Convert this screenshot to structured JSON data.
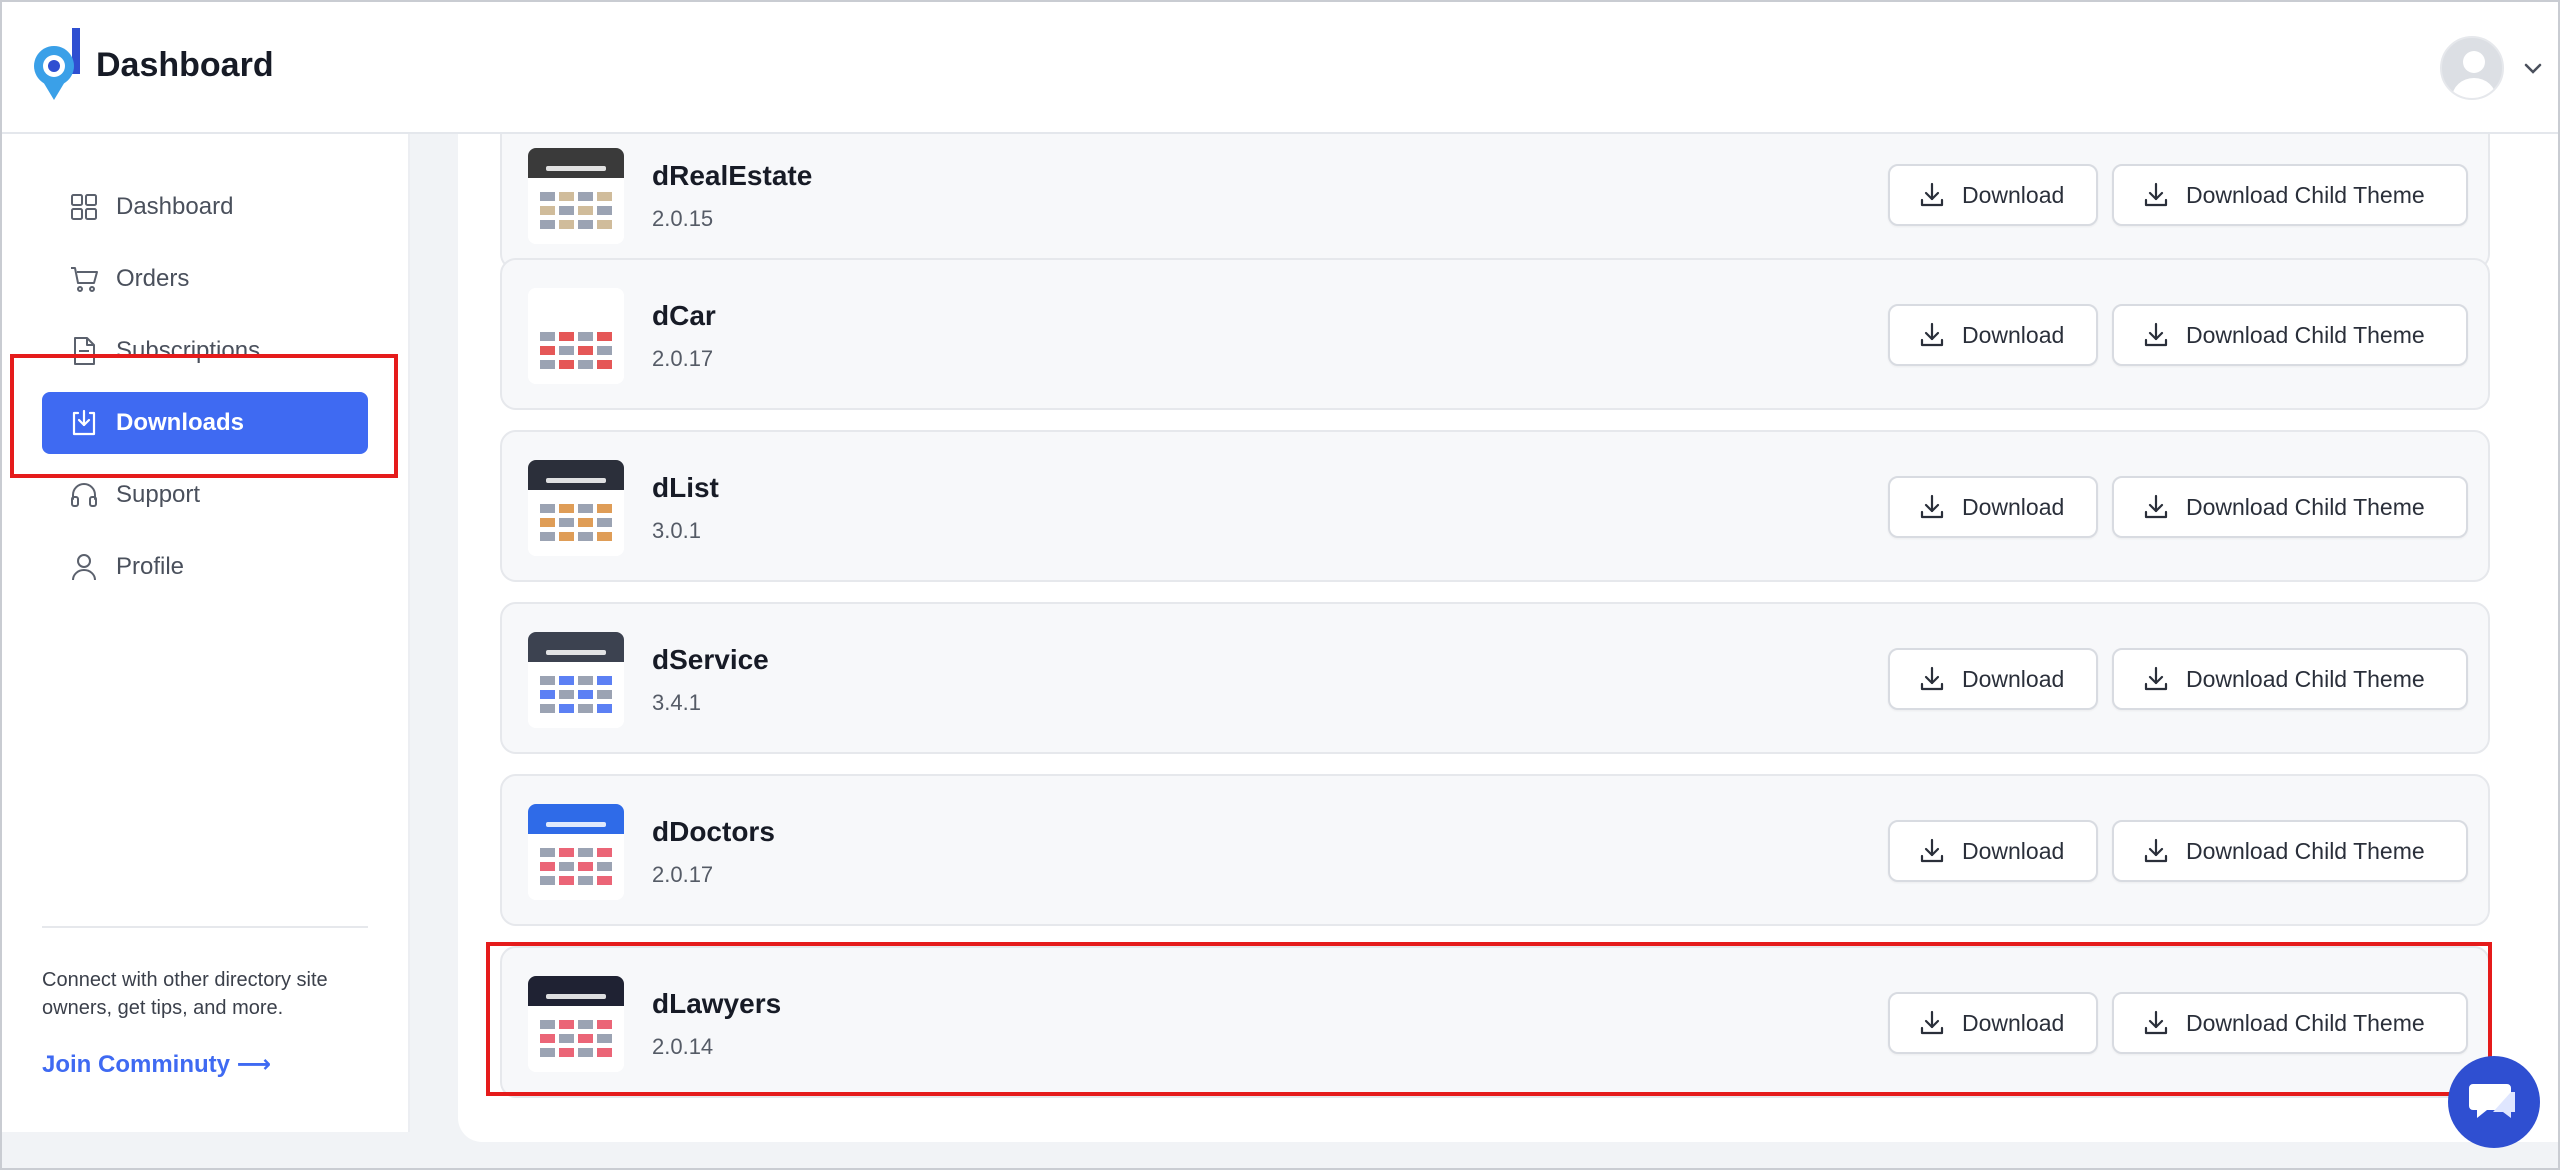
{
  "header": {
    "title": "Dashboard",
    "avatar_icon": "user-avatar",
    "menu_icon": "chevron-down-icon"
  },
  "sidebar": {
    "items": [
      {
        "label": "Dashboard",
        "icon": "grid-icon"
      },
      {
        "label": "Orders",
        "icon": "cart-icon"
      },
      {
        "label": "Subscriptions",
        "icon": "document-icon"
      },
      {
        "label": "Downloads",
        "icon": "download-tray-icon",
        "active": true
      },
      {
        "label": "Support",
        "icon": "headset-icon"
      },
      {
        "label": "Profile",
        "icon": "user-icon"
      }
    ],
    "community_text": "Connect with other directory site owners, get tips, and more.",
    "community_link": "Join Comminuty ⟶"
  },
  "downloads": [
    {
      "name": "dRealEstate",
      "version": "2.0.15",
      "download_label": "Download",
      "child_label": "Download Child Theme"
    },
    {
      "name": "dCar",
      "version": "2.0.17",
      "download_label": "Download",
      "child_label": "Download Child Theme"
    },
    {
      "name": "dList",
      "version": "3.0.1",
      "download_label": "Download",
      "child_label": "Download Child Theme"
    },
    {
      "name": "dService",
      "version": "3.4.1",
      "download_label": "Download",
      "child_label": "Download Child Theme"
    },
    {
      "name": "dDoctors",
      "version": "2.0.17",
      "download_label": "Download",
      "child_label": "Download Child Theme"
    },
    {
      "name": "dLawyers",
      "version": "2.0.14",
      "download_label": "Download",
      "child_label": "Download Child Theme"
    }
  ],
  "colors": {
    "accent": "#3f6af2",
    "highlight": "#e51b1b",
    "chat": "#2f4fd1"
  },
  "chat": {
    "icon": "chat-bubble-icon"
  }
}
